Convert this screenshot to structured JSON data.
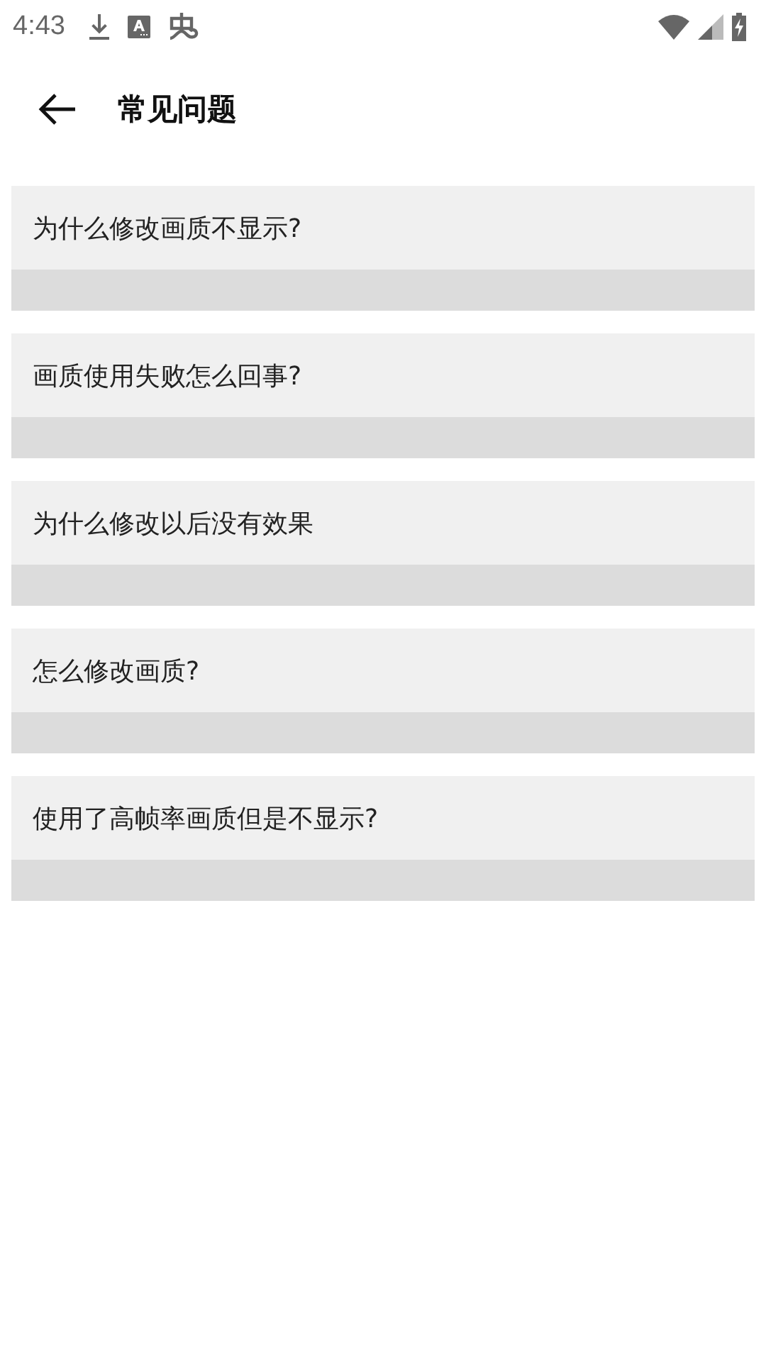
{
  "status_bar": {
    "time": "4:43"
  },
  "header": {
    "title": "常见问题"
  },
  "faq": [
    {
      "question": "为什么修改画质不显示?"
    },
    {
      "question": "画质使用失败怎么回事?"
    },
    {
      "question": "为什么修改以后没有效果"
    },
    {
      "question": "怎么修改画质?"
    },
    {
      "question": "使用了高帧率画质但是不显示?"
    }
  ]
}
